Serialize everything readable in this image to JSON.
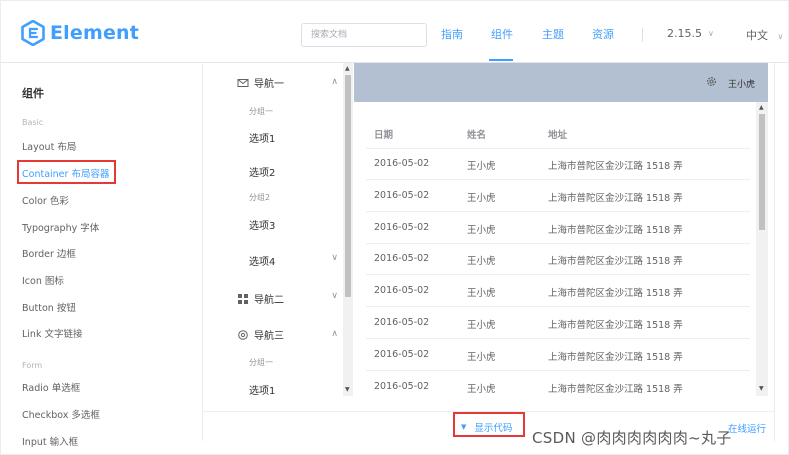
{
  "header": {
    "logo_text": "Element",
    "search_placeholder": "搜索文档",
    "nav": [
      "指南",
      "组件",
      "主题",
      "资源"
    ],
    "active_nav": "组件",
    "version": "2.15.5",
    "language": "中文"
  },
  "sidebar": {
    "title": "组件",
    "group_basic": "Basic",
    "basic_items": [
      "Layout 布局",
      "Container 布局容器",
      "Color 色彩",
      "Typography 字体",
      "Border 边框",
      "Icon 图标",
      "Button 按钮",
      "Link 文字链接"
    ],
    "active_item": "Container 布局容器",
    "group_form": "Form",
    "form_items": [
      "Radio 单选框",
      "Checkbox 多选框",
      "Input 输入框"
    ]
  },
  "demo": {
    "menu": {
      "nav1_title": "导航一",
      "nav1_group1": "分组一",
      "nav1_item1": "选项1",
      "nav1_item2": "选项2",
      "nav1_group2": "分组2",
      "nav1_item3": "选项3",
      "nav1_item4": "选项4",
      "nav2_title": "导航二",
      "nav3_title": "导航三",
      "nav3_group1": "分组一",
      "nav3_item1": "选项1"
    },
    "header_user": "王小虎",
    "table": {
      "columns": [
        "日期",
        "姓名",
        "地址"
      ],
      "rows": [
        [
          "2016-05-02",
          "王小虎",
          "上海市普陀区金沙江路 1518 弄"
        ],
        [
          "2016-05-02",
          "王小虎",
          "上海市普陀区金沙江路 1518 弄"
        ],
        [
          "2016-05-02",
          "王小虎",
          "上海市普陀区金沙江路 1518 弄"
        ],
        [
          "2016-05-02",
          "王小虎",
          "上海市普陀区金沙江路 1518 弄"
        ],
        [
          "2016-05-02",
          "王小虎",
          "上海市普陀区金沙江路 1518 弄"
        ],
        [
          "2016-05-02",
          "王小虎",
          "上海市普陀区金沙江路 1518 弄"
        ],
        [
          "2016-05-02",
          "王小虎",
          "上海市普陀区金沙江路 1518 弄"
        ],
        [
          "2016-05-02",
          "王小虎",
          "上海市普陀区金沙江路 1518 弄"
        ]
      ]
    },
    "show_code_label": "显示代码",
    "online_run_label": "在线运行"
  },
  "watermark": "CSDN @肉肉肉肉肉肉~丸子",
  "colors": {
    "brand": "#409eff",
    "header_bg": "#b3c0d1",
    "highlight": "#e53935"
  }
}
